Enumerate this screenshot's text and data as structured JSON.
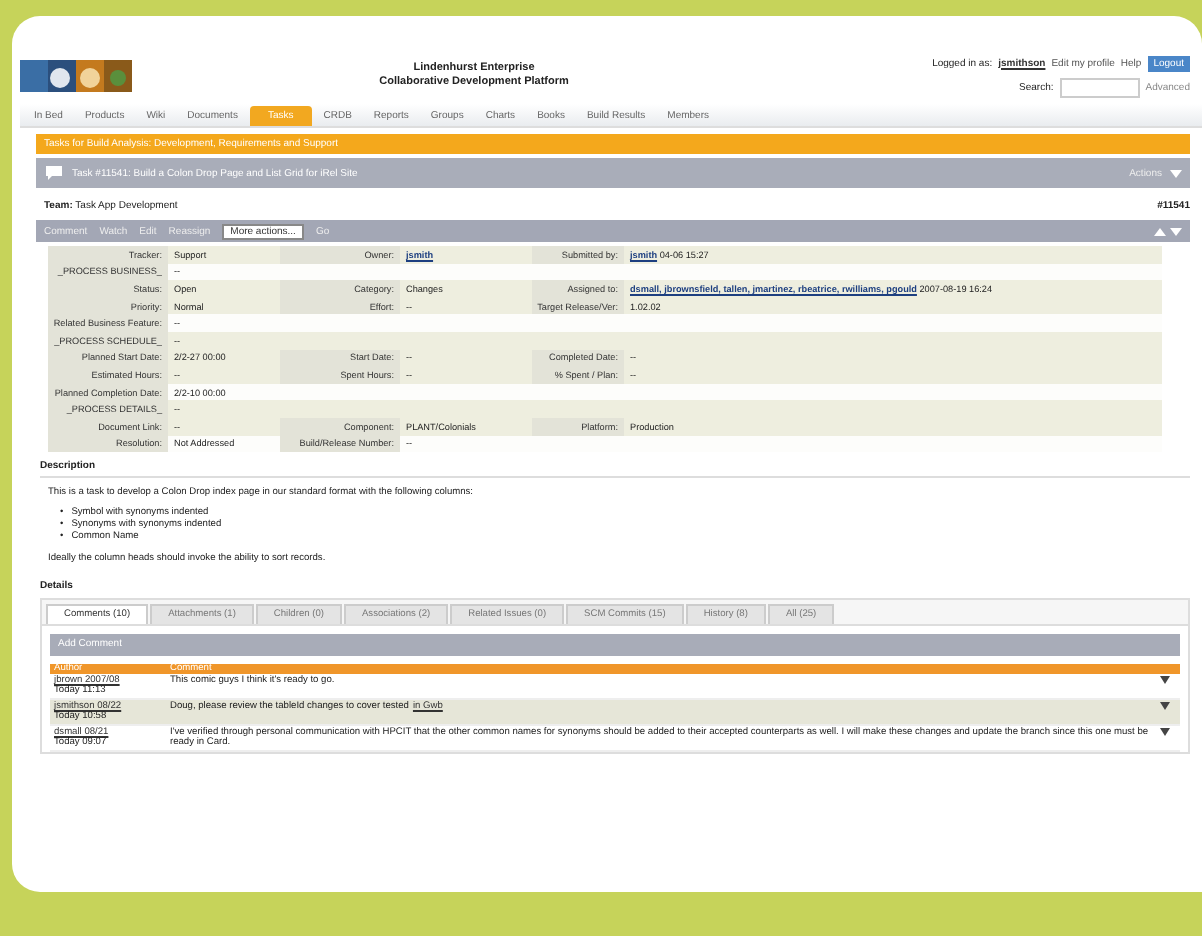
{
  "header": {
    "title_lines": [
      "Lindenhurst Enterprise",
      "Collaborative Development Platform"
    ],
    "login_label": "Logged in as:",
    "user": "jsmithson",
    "links": [
      "Edit my profile",
      "Help"
    ],
    "logout": "Logout",
    "search_label": "Search:",
    "search_button": "Advanced"
  },
  "nav": [
    {
      "label": "In Bed",
      "selected": false
    },
    {
      "label": "Products",
      "selected": false
    },
    {
      "label": "Wiki",
      "selected": false
    },
    {
      "label": "Documents",
      "selected": false
    },
    {
      "label": "Tasks",
      "selected": true
    },
    {
      "label": "CRDB",
      "selected": false
    },
    {
      "label": "Reports",
      "selected": false
    },
    {
      "label": "Groups",
      "selected": false
    },
    {
      "label": "Charts",
      "selected": false
    },
    {
      "label": "Books",
      "selected": false
    },
    {
      "label": "Build Results",
      "selected": false
    },
    {
      "label": "Members",
      "selected": false
    }
  ],
  "banner": "Tasks for Build Analysis: Development, Requirements and Support",
  "task": {
    "title": "Task #11541: Build a Colon Drop Page and List Grid for iRel Site",
    "actions": "Actions"
  },
  "team": {
    "label": "Team:",
    "value": "Task App Development",
    "id": "#11541"
  },
  "toolbar": {
    "buttons": [
      "Comment",
      "Watch",
      "Edit",
      "Reassign"
    ],
    "select": "More actions...",
    "go": "Go"
  },
  "fields": [
    {
      "shaded": true,
      "cells": [
        {
          "label": "Tracker:",
          "value": "Support",
          "link": false
        },
        {
          "label": "Owner:",
          "value": "jsmith",
          "link": true
        },
        {
          "label": "Submitted by:",
          "value": "jsmith",
          "link": true,
          "suffix": "04-06 15:27"
        }
      ]
    },
    {
      "shaded": false,
      "cells": [
        {
          "label": "_PROCESS BUSINESS_",
          "value": "--",
          "link": false
        }
      ]
    },
    {
      "shaded": true,
      "cells": [
        {
          "label": "Status:",
          "value": "Open",
          "link": false
        },
        {
          "label": "Category:",
          "value": "Changes",
          "link": false
        },
        {
          "label": "Assigned to:",
          "value": "dsmall, jbrownsfield, tallen, jmartinez, rbeatrice, rwilliams, pgould",
          "link": true,
          "suffix": "2007-08-19 16:24"
        }
      ]
    },
    {
      "shaded": true,
      "cells": [
        {
          "label": "Priority:",
          "value": "Normal",
          "link": false
        },
        {
          "label": "Effort:",
          "value": "--",
          "link": false
        },
        {
          "label": "Target Release/Ver:",
          "value": "1.02.02",
          "link": false
        }
      ]
    },
    {
      "shaded": false,
      "cells": [
        {
          "label": "Related Business Feature:",
          "value": "--",
          "link": false
        }
      ]
    },
    {
      "shaded": true,
      "cells": [
        {
          "label": "_PROCESS SCHEDULE_",
          "value": "--",
          "link": false
        }
      ]
    },
    {
      "shaded": true,
      "cells": [
        {
          "label": "Planned Start Date:",
          "value": "2/2-27 00:00",
          "link": false
        },
        {
          "label": "Start Date:",
          "value": "--",
          "link": false
        },
        {
          "label": "Completed Date:",
          "value": "--",
          "link": false
        }
      ]
    },
    {
      "shaded": true,
      "cells": [
        {
          "label": "Estimated Hours:",
          "value": "--",
          "link": false
        },
        {
          "label": "Spent Hours:",
          "value": "--",
          "link": false
        },
        {
          "label": "% Spent / Plan:",
          "value": "--",
          "link": false
        }
      ]
    },
    {
      "shaded": false,
      "cells": [
        {
          "label": "Planned Completion Date:",
          "value": "2/2-10 00:00",
          "link": false
        }
      ]
    },
    {
      "shaded": true,
      "cells": [
        {
          "label": "_PROCESS DETAILS_",
          "value": "--",
          "link": false
        }
      ]
    },
    {
      "shaded": true,
      "cells": [
        {
          "label": "Document Link:",
          "value": "--",
          "link": false
        },
        {
          "label": "Component:",
          "value": "PLANT/Colonials",
          "link": false
        },
        {
          "label": "Platform:",
          "value": "Production",
          "link": false
        }
      ]
    },
    {
      "shaded": false,
      "cells": [
        {
          "label": "Resolution:",
          "value": "Not Addressed",
          "link": false
        },
        {
          "label": "Build/Release Number:",
          "value": "--",
          "link": false
        }
      ]
    }
  ],
  "description": {
    "heading": "Description",
    "intro": "This is a task to develop a Colon Drop index page in our standard format with the following columns:",
    "marker": "•",
    "bullets": [
      "Symbol with synonyms indented",
      "Synonyms with synonyms indented",
      "Common Name"
    ],
    "outro": "Ideally the column heads should invoke the ability to sort records."
  },
  "details": {
    "heading": "Details",
    "tabs": [
      {
        "label": "Comments (10)",
        "selected": true
      },
      {
        "label": "Attachments (1)",
        "selected": false
      },
      {
        "label": "Children (0)",
        "selected": false
      },
      {
        "label": "Associations (2)",
        "selected": false
      },
      {
        "label": "Related Issues (0)",
        "selected": false
      },
      {
        "label": "SCM Commits (15)",
        "selected": false
      },
      {
        "label": "History (8)",
        "selected": false
      },
      {
        "label": "All (25)",
        "selected": false
      }
    ],
    "add_comment": "Add Comment",
    "columns": [
      "Author",
      "Comment"
    ],
    "comments": [
      {
        "author": "jbrown 2007/08",
        "date": "Today 11:13",
        "text": "This comic guys I think it's ready to go.",
        "shaded": false
      },
      {
        "author": "jsmithson 08/22",
        "date": "Today 10:58",
        "text": "Doug, please review the tableId changes to cover tested",
        "link": "in Gwb",
        "shaded": true
      },
      {
        "author": "dsmall 08/21",
        "date": "Today 09:07",
        "text": "I've verified through personal communication with HPCIT that the other common names for synonyms should be added to their accepted counterparts as well. I will make these changes and update the branch since this one must be ready in Card.",
        "shaded": false
      }
    ]
  }
}
